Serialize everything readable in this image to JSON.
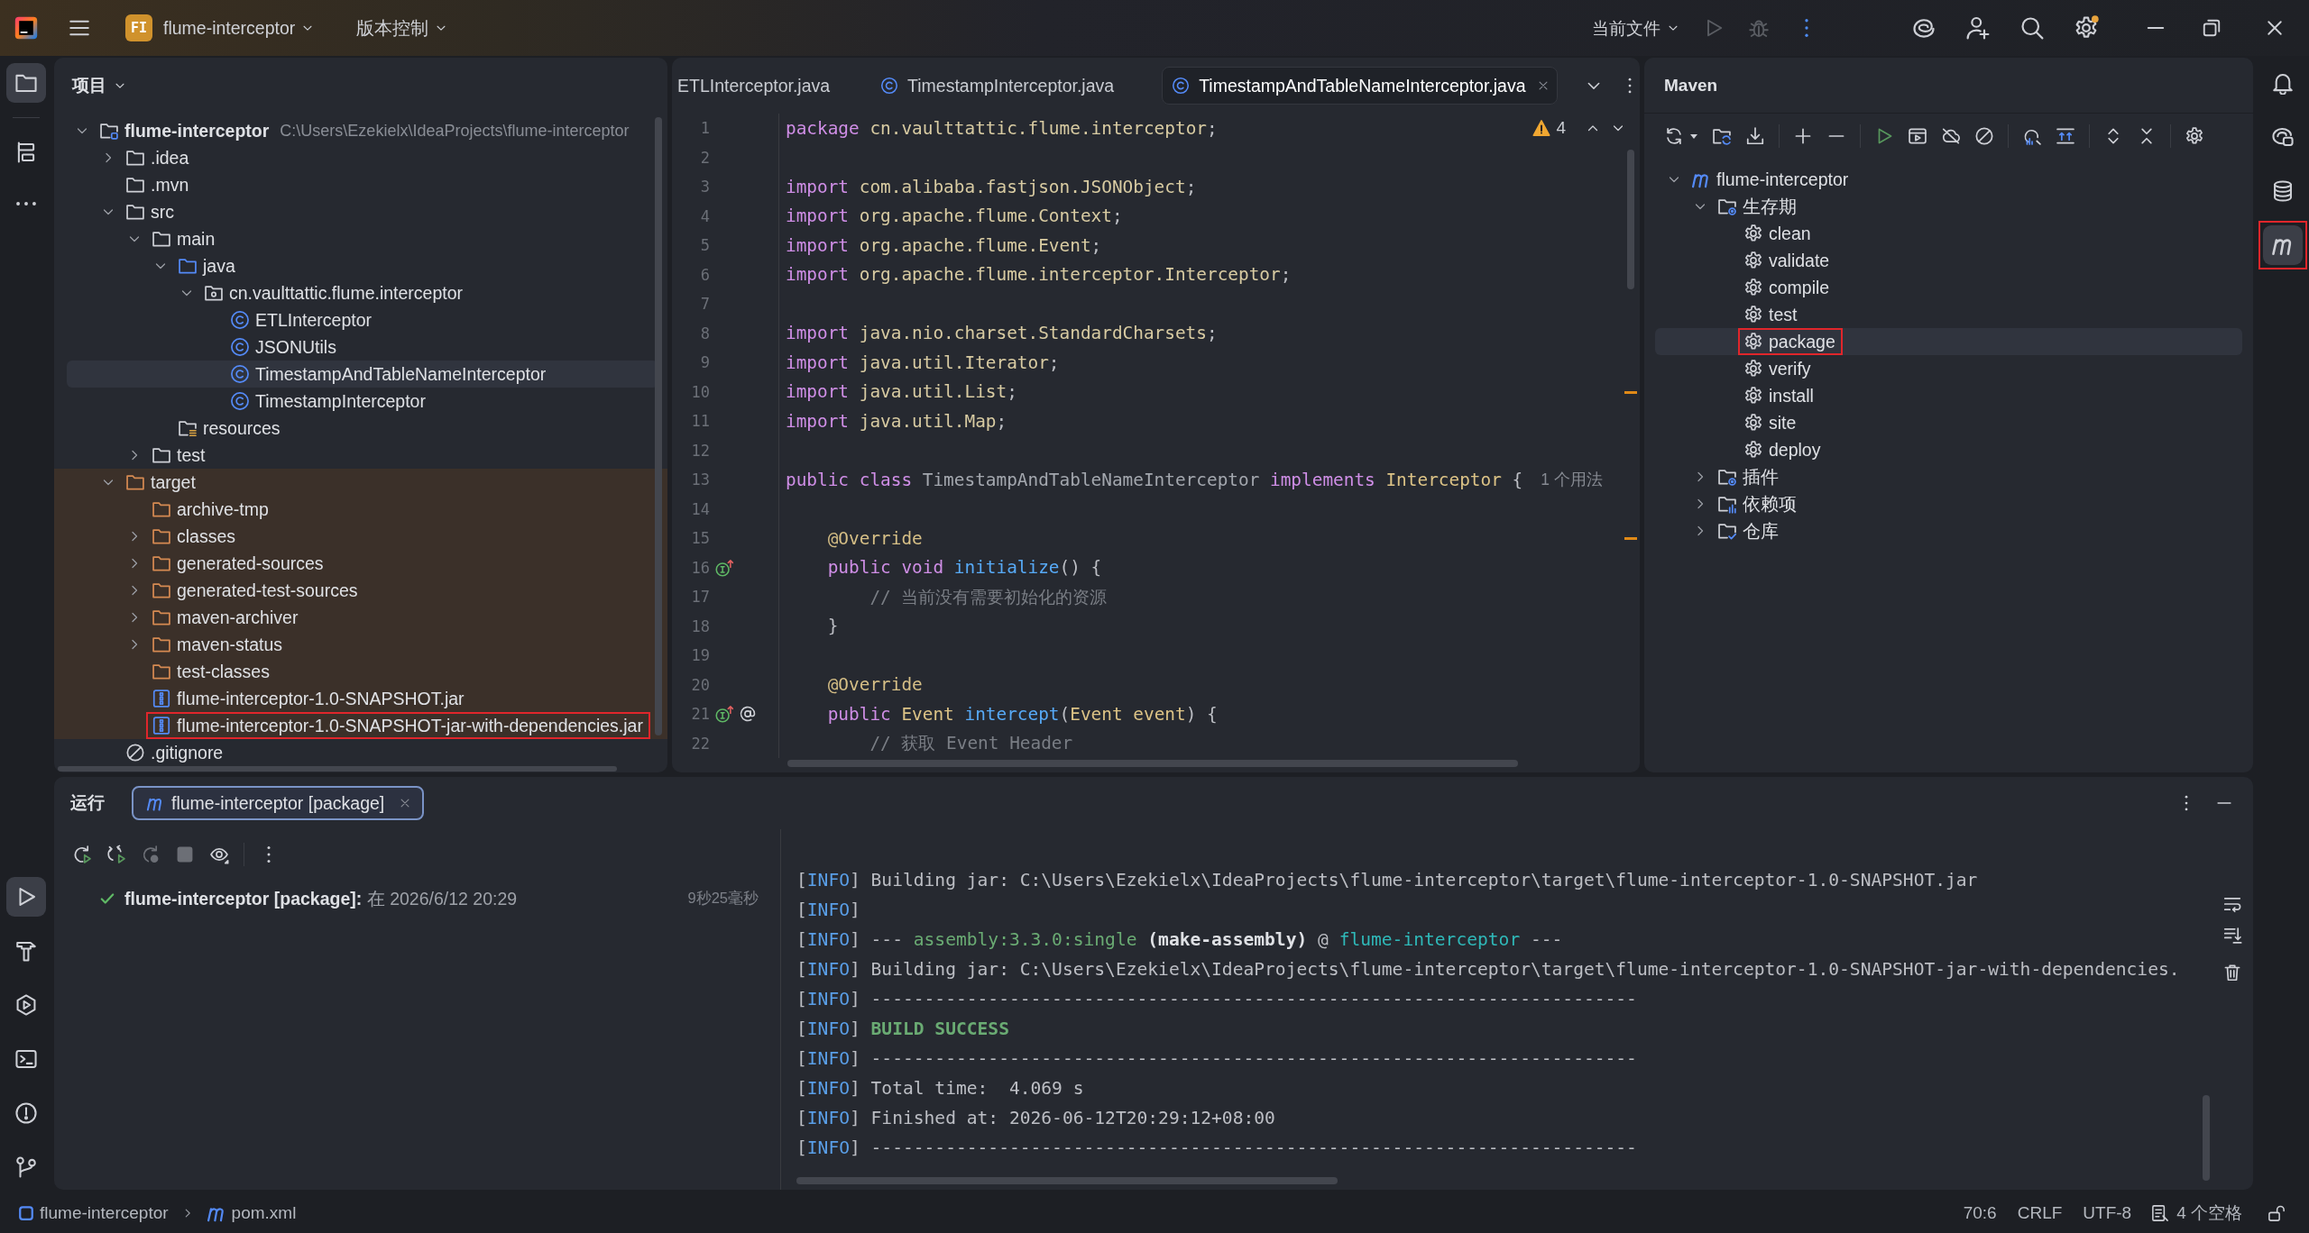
{
  "title_bar": {
    "project_badge": "FI",
    "project": "flume-interceptor",
    "vcs_menu": "版本控制",
    "run_configuration": "当前文件"
  },
  "left_strip": {
    "top": [
      {
        "kind": "project",
        "selected": true
      },
      {
        "kind": "structure",
        "selected": false
      },
      {
        "kind": "more",
        "selected": false
      }
    ],
    "bottom": [
      {
        "kind": "run",
        "selected": true
      },
      {
        "kind": "build",
        "selected": false
      },
      {
        "kind": "services",
        "selected": false
      },
      {
        "kind": "terminal",
        "selected": false
      },
      {
        "kind": "problems",
        "selected": false
      },
      {
        "kind": "git",
        "selected": false
      }
    ]
  },
  "project_panel": {
    "title": "项目",
    "tree": [
      {
        "label": "flume-interceptor",
        "path": "C:\\Users\\Ezekielx\\IdeaProjects\\flume-interceptor",
        "kind": "module",
        "expanded": true,
        "selected": false,
        "annotated": false,
        "children": [
          {
            "label": ".idea",
            "kind": "folder",
            "expanded": false,
            "excluded": false,
            "selected": false,
            "annotated": false
          },
          {
            "label": ".mvn",
            "kind": "folder",
            "excluded": false,
            "selected": false,
            "annotated": false
          },
          {
            "label": "src",
            "kind": "folder",
            "expanded": true,
            "excluded": false,
            "selected": false,
            "annotated": false,
            "children": [
              {
                "label": "main",
                "kind": "folder",
                "expanded": true,
                "selected": false,
                "annotated": false,
                "children": [
                  {
                    "label": "java",
                    "kind": "source-folder",
                    "expanded": true,
                    "selected": false,
                    "annotated": false,
                    "children": [
                      {
                        "label": "cn.vaulttattic.flume.interceptor",
                        "kind": "package",
                        "expanded": true,
                        "selected": false,
                        "annotated": false,
                        "children": [
                          {
                            "label": "ETLInterceptor",
                            "kind": "class",
                            "selected": false,
                            "annotated": false
                          },
                          {
                            "label": "JSONUtils",
                            "kind": "class",
                            "selected": false,
                            "annotated": false
                          },
                          {
                            "label": "TimestampAndTableNameInterceptor",
                            "kind": "class",
                            "selected": true,
                            "annotated": false
                          },
                          {
                            "label": "TimestampInterceptor",
                            "kind": "class",
                            "selected": false,
                            "annotated": false
                          }
                        ]
                      }
                    ]
                  },
                  {
                    "label": "resources",
                    "kind": "resources",
                    "selected": false,
                    "annotated": false
                  }
                ]
              },
              {
                "label": "test",
                "kind": "folder",
                "expanded": false,
                "selected": false,
                "annotated": false
              }
            ]
          },
          {
            "label": "target",
            "kind": "folder",
            "expanded": true,
            "excluded": true,
            "selected": false,
            "annotated": false,
            "children": [
              {
                "label": "archive-tmp",
                "kind": "folder",
                "selected": false,
                "annotated": false
              },
              {
                "label": "classes",
                "kind": "folder",
                "expanded": false,
                "selected": false,
                "annotated": false
              },
              {
                "label": "generated-sources",
                "kind": "folder",
                "expanded": false,
                "selected": false,
                "annotated": false
              },
              {
                "label": "generated-test-sources",
                "kind": "folder",
                "expanded": false,
                "selected": false,
                "annotated": false
              },
              {
                "label": "maven-archiver",
                "kind": "folder",
                "expanded": false,
                "selected": false,
                "annotated": false
              },
              {
                "label": "maven-status",
                "kind": "folder",
                "expanded": false,
                "selected": false,
                "annotated": false
              },
              {
                "label": "test-classes",
                "kind": "folder",
                "selected": false,
                "annotated": false
              },
              {
                "label": "flume-interceptor-1.0-SNAPSHOT.jar",
                "kind": "jar",
                "selected": false,
                "annotated": false
              },
              {
                "label": "flume-interceptor-1.0-SNAPSHOT-jar-with-dependencies.jar",
                "kind": "jar",
                "selected": false,
                "annotated": true
              }
            ]
          },
          {
            "label": ".gitignore",
            "kind": "ignore",
            "excluded": false,
            "selected": false,
            "annotated": false
          }
        ]
      }
    ]
  },
  "editor": {
    "tabs": [
      {
        "label": "ETLInterceptor.java",
        "kind": "cut",
        "selected": false
      },
      {
        "label": "TimestampInterceptor.java",
        "kind": "class",
        "selected": false
      },
      {
        "label": "TimestampAndTableNameInterceptor.java",
        "kind": "class",
        "selected": true
      }
    ],
    "warnings": "4",
    "lines": [
      {
        "number": "1",
        "kind": "code",
        "marked": false,
        "tokens": [
          {
            "text": "package",
            "kind": "keyword"
          },
          {
            "text": " cn.vaulttattic.flume.interceptor",
            "kind": "name"
          },
          {
            "text": ";",
            "kind": "plain"
          }
        ]
      },
      {
        "number": "2",
        "kind": "code",
        "marked": false
      },
      {
        "number": "3",
        "kind": "code",
        "marked": false,
        "tokens": [
          {
            "text": "import",
            "kind": "keyword"
          },
          {
            "text": " com.alibaba.fastjson.JSONObject",
            "kind": "name"
          },
          {
            "text": ";",
            "kind": "plain"
          }
        ]
      },
      {
        "number": "4",
        "kind": "code",
        "marked": false,
        "tokens": [
          {
            "text": "import",
            "kind": "keyword"
          },
          {
            "text": " org.apache.flume.Context",
            "kind": "name"
          },
          {
            "text": ";",
            "kind": "plain"
          }
        ]
      },
      {
        "number": "5",
        "kind": "code",
        "marked": false,
        "tokens": [
          {
            "text": "import",
            "kind": "keyword"
          },
          {
            "text": " org.apache.flume.Event",
            "kind": "name"
          },
          {
            "text": ";",
            "kind": "plain"
          }
        ]
      },
      {
        "number": "6",
        "kind": "code",
        "marked": false,
        "tokens": [
          {
            "text": "import",
            "kind": "keyword"
          },
          {
            "text": " org.apache.flume.interceptor.Interceptor",
            "kind": "name"
          },
          {
            "text": ";",
            "kind": "plain"
          }
        ]
      },
      {
        "number": "7",
        "kind": "code",
        "marked": false
      },
      {
        "number": "8",
        "kind": "code",
        "marked": false,
        "tokens": [
          {
            "text": "import",
            "kind": "keyword"
          },
          {
            "text": " java.nio.charset.StandardCharsets",
            "kind": "name"
          },
          {
            "text": ";",
            "kind": "plain"
          }
        ]
      },
      {
        "number": "9",
        "kind": "code",
        "marked": false,
        "tokens": [
          {
            "text": "import",
            "kind": "keyword"
          },
          {
            "text": " java.util.Iterator",
            "kind": "name"
          },
          {
            "text": ";",
            "kind": "plain"
          }
        ]
      },
      {
        "number": "10",
        "kind": "code",
        "marked": true,
        "tokens": [
          {
            "text": "import",
            "kind": "keyword"
          },
          {
            "text": " java.util.List",
            "kind": "name"
          },
          {
            "text": ";",
            "kind": "plain"
          }
        ]
      },
      {
        "number": "11",
        "kind": "code",
        "marked": false,
        "tokens": [
          {
            "text": "import",
            "kind": "keyword"
          },
          {
            "text": " java.util.Map",
            "kind": "name"
          },
          {
            "text": ";",
            "kind": "plain"
          }
        ]
      },
      {
        "number": "12",
        "kind": "code",
        "marked": false
      },
      {
        "number": "13",
        "kind": "code",
        "marked": false,
        "hint": "1 个用法",
        "tokens": [
          {
            "text": "public class",
            "kind": "keyword"
          },
          {
            "text": " TimestampAndTableNameInterceptor ",
            "kind": "dim"
          },
          {
            "text": "implements",
            "kind": "keyword"
          },
          {
            "text": " Interceptor",
            "kind": "type"
          },
          {
            "text": " {",
            "kind": "plain"
          }
        ]
      },
      {
        "number": "14",
        "kind": "code",
        "marked": false
      },
      {
        "number": "15",
        "kind": "code",
        "marked": true,
        "tokens": [
          {
            "text": "    @Override",
            "kind": "annotation"
          }
        ]
      },
      {
        "number": "16",
        "kind": "implements",
        "marked": false,
        "tokens": [
          {
            "text": "    public void",
            "kind": "keyword"
          },
          {
            "text": " initialize",
            "kind": "function"
          },
          {
            "text": "() {",
            "kind": "plain"
          }
        ]
      },
      {
        "number": "17",
        "kind": "code",
        "marked": false,
        "tokens": [
          {
            "text": "        // 当前没有需要初始化的资源",
            "kind": "comment"
          }
        ]
      },
      {
        "number": "18",
        "kind": "code",
        "marked": false,
        "tokens": [
          {
            "text": "    }",
            "kind": "plain"
          }
        ]
      },
      {
        "number": "19",
        "kind": "code",
        "marked": false
      },
      {
        "number": "20",
        "kind": "code",
        "marked": false,
        "tokens": [
          {
            "text": "    @Override",
            "kind": "annotation"
          }
        ]
      },
      {
        "number": "21",
        "kind": "implements-at",
        "marked": false,
        "tokens": [
          {
            "text": "    public",
            "kind": "keyword"
          },
          {
            "text": " Event",
            "kind": "type"
          },
          {
            "text": " intercept",
            "kind": "function"
          },
          {
            "text": "(",
            "kind": "plain"
          },
          {
            "text": "Event event",
            "kind": "type"
          },
          {
            "text": ") {",
            "kind": "plain"
          }
        ]
      },
      {
        "number": "22",
        "kind": "code",
        "marked": false,
        "tokens": [
          {
            "text": "        // 获取 Event Header",
            "kind": "comment"
          }
        ]
      }
    ]
  },
  "maven_panel": {
    "title": "Maven",
    "tree": [
      {
        "label": "flume-interceptor",
        "kind": "project",
        "expanded": true,
        "selected": false,
        "annotated": false,
        "children": [
          {
            "label": "生存期",
            "kind": "lifecycle",
            "expanded": true,
            "selected": false,
            "annotated": false,
            "children": [
              {
                "label": "clean",
                "kind": "goal",
                "selected": false,
                "annotated": false
              },
              {
                "label": "validate",
                "kind": "goal",
                "selected": false,
                "annotated": false
              },
              {
                "label": "compile",
                "kind": "goal",
                "selected": false,
                "annotated": false
              },
              {
                "label": "test",
                "kind": "goal",
                "selected": false,
                "annotated": false
              },
              {
                "label": "package",
                "kind": "goal",
                "selected": true,
                "annotated": true
              },
              {
                "label": "verify",
                "kind": "goal",
                "selected": false,
                "annotated": false
              },
              {
                "label": "install",
                "kind": "goal",
                "selected": false,
                "annotated": false
              },
              {
                "label": "site",
                "kind": "goal",
                "selected": false,
                "annotated": false
              },
              {
                "label": "deploy",
                "kind": "goal",
                "selected": false,
                "annotated": false
              }
            ]
          },
          {
            "label": "插件",
            "kind": "plugins",
            "expanded": false,
            "selected": false,
            "annotated": false
          },
          {
            "label": "依赖项",
            "kind": "dependencies",
            "expanded": false,
            "selected": false,
            "annotated": false
          },
          {
            "label": "仓库",
            "kind": "repositories",
            "expanded": false,
            "selected": false,
            "annotated": false
          }
        ]
      }
    ]
  },
  "right_strip": [
    {
      "kind": "notifications",
      "selected": false,
      "annotated": false
    },
    {
      "kind": "ai-chat",
      "selected": false,
      "annotated": false
    },
    {
      "kind": "database",
      "selected": false,
      "annotated": false
    },
    {
      "kind": "maven",
      "selected": true,
      "annotated": true
    }
  ],
  "run_panel": {
    "title": "运行",
    "tabs": [
      {
        "label": "flume-interceptor [package]",
        "selected": true
      }
    ],
    "tree": [
      {
        "kind": "success",
        "label": "**flume-interceptor [package]:** 在 2026/6/12 20:29",
        "duration": "9秒25毫秒"
      }
    ],
    "console": [
      {
        "segments": [
          {
            "text": "[",
            "kind": "plain"
          },
          {
            "text": "INFO",
            "kind": "level"
          },
          {
            "text": "] Building jar: C:\\Users\\Ezekielx\\IdeaProjects\\flume-interceptor\\target\\flume-interceptor-1.0-SNAPSHOT.jar",
            "kind": "plain"
          }
        ]
      },
      {
        "segments": [
          {
            "text": "[",
            "kind": "plain"
          },
          {
            "text": "INFO",
            "kind": "level"
          },
          {
            "text": "]",
            "kind": "plain"
          }
        ]
      },
      {
        "segments": [
          {
            "text": "[",
            "kind": "plain"
          },
          {
            "text": "INFO",
            "kind": "level"
          },
          {
            "text": "] --- ",
            "kind": "plain"
          },
          {
            "text": "assembly:3.3.0:single",
            "kind": "goal"
          },
          {
            "text": " (make-assembly)",
            "kind": "bold"
          },
          {
            "text": " @ ",
            "kind": "plain"
          },
          {
            "text": "flume-interceptor",
            "kind": "project"
          },
          {
            "text": " ---",
            "kind": "plain"
          }
        ]
      },
      {
        "segments": [
          {
            "text": "[",
            "kind": "plain"
          },
          {
            "text": "INFO",
            "kind": "level"
          },
          {
            "text": "] Building jar: C:\\Users\\Ezekielx\\IdeaProjects\\flume-interceptor\\target\\flume-interceptor-1.0-SNAPSHOT-jar-with-dependencies.",
            "kind": "plain"
          }
        ]
      },
      {
        "segments": [
          {
            "text": "[",
            "kind": "plain"
          },
          {
            "text": "INFO",
            "kind": "level"
          },
          {
            "text": "] ------------------------------------------------------------------------",
            "kind": "plain"
          }
        ]
      },
      {
        "segments": [
          {
            "text": "[",
            "kind": "plain"
          },
          {
            "text": "INFO",
            "kind": "level"
          },
          {
            "text": "] ",
            "kind": "plain"
          },
          {
            "text": "BUILD SUCCESS",
            "kind": "success"
          }
        ]
      },
      {
        "segments": [
          {
            "text": "[",
            "kind": "plain"
          },
          {
            "text": "INFO",
            "kind": "level"
          },
          {
            "text": "] ------------------------------------------------------------------------",
            "kind": "plain"
          }
        ]
      },
      {
        "segments": [
          {
            "text": "[",
            "kind": "plain"
          },
          {
            "text": "INFO",
            "kind": "level"
          },
          {
            "text": "] Total time:  4.069 s",
            "kind": "plain"
          }
        ]
      },
      {
        "segments": [
          {
            "text": "[",
            "kind": "plain"
          },
          {
            "text": "INFO",
            "kind": "level"
          },
          {
            "text": "] Finished at: 2026-06-12T20:29:12+08:00",
            "kind": "plain"
          }
        ]
      },
      {
        "segments": [
          {
            "text": "[",
            "kind": "plain"
          },
          {
            "text": "INFO",
            "kind": "level"
          },
          {
            "text": "] ------------------------------------------------------------------------",
            "kind": "plain"
          }
        ]
      }
    ]
  },
  "status_bar": {
    "breadcrumbs": [
      {
        "label": "flume-interceptor",
        "kind": "module"
      },
      {
        "label": "pom.xml",
        "kind": "maven"
      }
    ],
    "caret_position": "70:6",
    "line_separator": "CRLF",
    "encoding": "UTF-8",
    "indentation": "4 个空格"
  }
}
